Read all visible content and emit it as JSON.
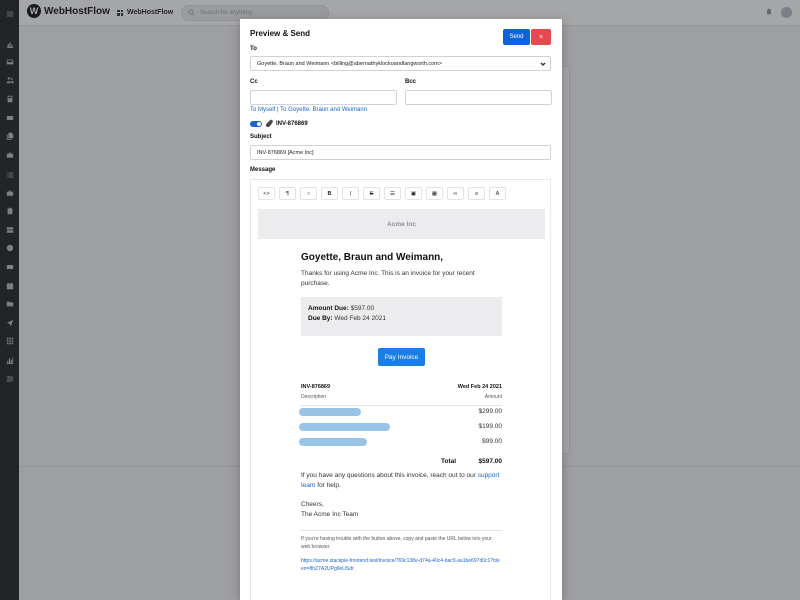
{
  "app": {
    "name": "WebHostFlow",
    "logo_letter": "W",
    "switcher_label": "WebHostFlow",
    "search_placeholder": "Search for anything"
  },
  "rail_icons": [
    "menu-icon",
    "chart-icon",
    "inbox-icon",
    "users-icon",
    "calculator-icon",
    "card-icon",
    "docs-icon",
    "briefcase-icon",
    "list-icon",
    "briefcase-icon",
    "clipboard-icon",
    "server-icon",
    "globe-icon",
    "mail-icon",
    "calendar-icon",
    "folder-icon",
    "send-icon",
    "apps-icon",
    "bar-chart-icon",
    "settings-list-icon"
  ],
  "modal": {
    "title": "Preview & Send",
    "send_label": "Send",
    "close_label": "×",
    "to_label": "To",
    "to_value": "Goyette, Braun and Weimann <billing@abernathyklockoandlangworth.com>",
    "cc_label": "Cc",
    "cc_value": "",
    "bcc_label": "Bcc",
    "bcc_value": "",
    "quick_myself": "To Myself",
    "quick_sep": " | ",
    "quick_client": "To Goyette, Braun and Weimann",
    "attachment_toggle": true,
    "attachment_name": "INV-876869",
    "subject_label": "Subject",
    "subject_value": "INV-876869 [Acme Inc]",
    "message_label": "Message"
  },
  "editor_toolbar": [
    {
      "name": "code-view-icon",
      "glyph": "<>"
    },
    {
      "name": "paragraph-icon",
      "glyph": "¶"
    },
    {
      "name": "color-icon",
      "glyph": "○"
    },
    {
      "name": "bold-icon",
      "glyph": "B"
    },
    {
      "name": "italic-icon",
      "glyph": "I"
    },
    {
      "name": "strikethrough-icon",
      "glyph": "S"
    },
    {
      "name": "list-icon",
      "glyph": "☰"
    },
    {
      "name": "image-icon",
      "glyph": "▣"
    },
    {
      "name": "table-icon",
      "glyph": "▦"
    },
    {
      "name": "link-icon",
      "glyph": "∞"
    },
    {
      "name": "align-icon",
      "glyph": "≡"
    },
    {
      "name": "text-style-icon",
      "glyph": "A"
    }
  ],
  "email": {
    "brand": "Acme Inc",
    "greeting": "Goyette, Braun and Weimann,",
    "intro": "Thanks for using Acme Inc. This is an invoice for your recent purchase.",
    "amount_due_label": "Amount Due:",
    "amount_due_value": "$597.00",
    "due_by_label": "Due By:",
    "due_by_value": "Wed Feb 24 2021",
    "pay_button": "Pay Invoice",
    "invoice_number": "INV-876869",
    "invoice_date": "Wed Feb 24 2021",
    "col_description": "Description",
    "col_amount": "Amount",
    "line_items": [
      {
        "amount": "$299.00"
      },
      {
        "amount": "$199.00"
      },
      {
        "amount": "$99.00"
      }
    ],
    "total_label": "Total",
    "total_value": "$597.00",
    "help_text_pre": "If you have any questions about this invoice, reach out to our ",
    "help_link": "support team",
    "help_text_post": " for help.",
    "signoff_1": "Cheers,",
    "signoff_2": "The Acme Inc Team",
    "fine_print": "If you're having trouble with the button above, copy and paste the URL below into your web browser.",
    "url": "https://acme.stackpie-frontend.test/invoice/769c138e-d74a-40c4-bac0-aa1be697d0c1?token=8hZ7A2UPg9eUSdr"
  },
  "colors": {
    "primary": "#0d64d8",
    "danger": "#e8484f",
    "link": "#1b66c9",
    "rail": "#1e1f23"
  }
}
